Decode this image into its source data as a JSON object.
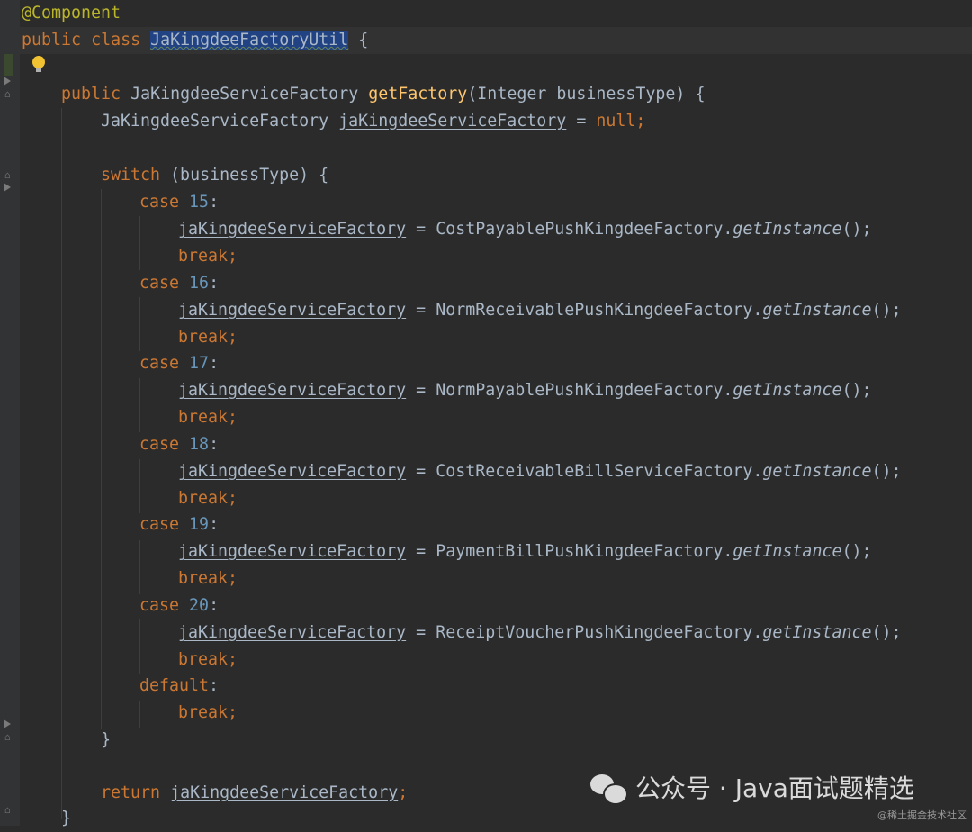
{
  "editor": {
    "lines": [
      {
        "annotation": "@Component"
      },
      {
        "kw1": "public",
        "kw2": "class",
        "class_name": "JaKingdeeFactoryUtil",
        "brace": "{"
      },
      {
        "kw1": "public",
        "type": "JaKingdeeServiceFactory",
        "method": "getFactory",
        "params": "(Integer businessType) {"
      },
      {
        "type": "JaKingdeeServiceFactory",
        "var": "jaKingdeeServiceFactory",
        "eq": " = ",
        "null_kw": "null",
        "semi": ";"
      },
      {
        "kw": "switch",
        "rest": " (businessType) {"
      },
      {
        "kw": "case",
        "num": "15",
        "colon": ":"
      },
      {
        "var": "jaKingdeeServiceFactory",
        "eq": " = ",
        "factory": "CostPayablePushKingdeeFactory",
        "dot": ".",
        "call": "getInstance",
        "end": "();"
      },
      {
        "kw": "break;"
      },
      {
        "kw": "case",
        "num": "16",
        "colon": ":"
      },
      {
        "var": "jaKingdeeServiceFactory",
        "eq": " = ",
        "factory": "NormReceivablePushKingdeeFactory",
        "dot": ".",
        "call": "getInstance",
        "end": "();"
      },
      {
        "kw": "break;"
      },
      {
        "kw": "case",
        "num": "17",
        "colon": ":"
      },
      {
        "var": "jaKingdeeServiceFactory",
        "eq": " = ",
        "factory": "NormPayablePushKingdeeFactory",
        "dot": ".",
        "call": "getInstance",
        "end": "();"
      },
      {
        "kw": "break;"
      },
      {
        "kw": "case",
        "num": "18",
        "colon": ":"
      },
      {
        "var": "jaKingdeeServiceFactory",
        "eq": " = ",
        "factory": "CostReceivableBillServiceFactory",
        "dot": ".",
        "call": "getInstance",
        "end": "();"
      },
      {
        "kw": "break;"
      },
      {
        "kw": "case",
        "num": "19",
        "colon": ":"
      },
      {
        "var": "jaKingdeeServiceFactory",
        "eq": " = ",
        "factory": "PaymentBillPushKingdeeFactory",
        "dot": ".",
        "call": "getInstance",
        "end": "();"
      },
      {
        "kw": "break;"
      },
      {
        "kw": "case",
        "num": "20",
        "colon": ":"
      },
      {
        "var": "jaKingdeeServiceFactory",
        "eq": " = ",
        "factory": "ReceiptVoucherPushKingdeeFactory",
        "dot": ".",
        "call": "getInstance",
        "end": "();"
      },
      {
        "kw": "break;"
      },
      {
        "kw": "default",
        "colon": ":"
      },
      {
        "kw": "break;"
      },
      {
        "brace": "}"
      },
      {
        "kw": "return",
        "var": "jaKingdeeServiceFactory",
        "semi": ";"
      },
      {
        "brace": "}"
      }
    ]
  },
  "watermark": {
    "text": "公众号 · Java面试题精选",
    "small": "@稀土掘金技术社区"
  },
  "colors": {
    "background": "#2b2b2b",
    "keyword": "#cc7832",
    "annotation": "#bbb529",
    "method": "#ffc66d",
    "number": "#6897bb",
    "text": "#a9b7c6",
    "selection": "#214283"
  }
}
